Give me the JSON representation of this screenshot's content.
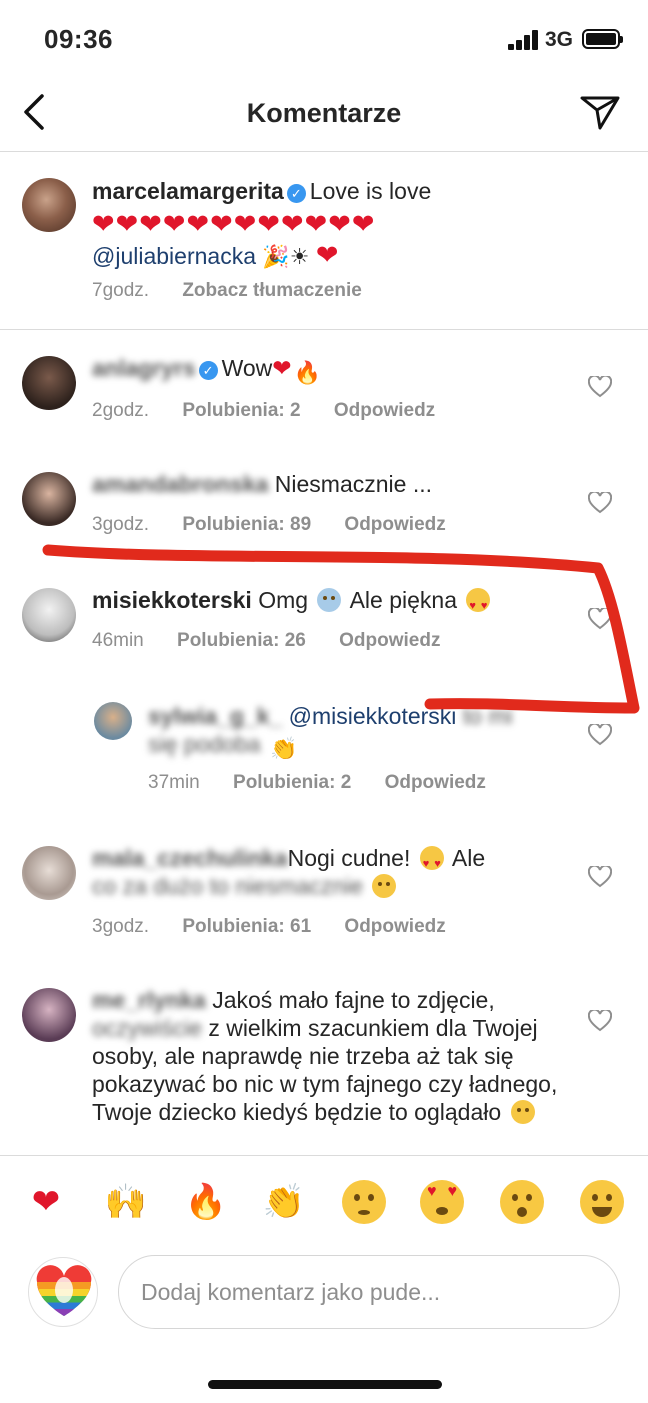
{
  "status": {
    "time": "09:36",
    "network": "3G"
  },
  "header": {
    "title": "Komentarze"
  },
  "caption": {
    "username": "marcelamargerita",
    "text": "Love is love",
    "hearts": "❤❤❤❤❤❤❤❤❤❤❤❤",
    "mention": "@juliabiernacka",
    "tail": "🎉☀",
    "heart": "❤",
    "time": "7godz.",
    "translate": "Zobacz tłumaczenie"
  },
  "comments": [
    {
      "username": "anlagryrs",
      "text": "Wow",
      "time": "2godz.",
      "likes": "Polubienia: 2",
      "reply": "Odpowiedz"
    },
    {
      "username": "amandabronska",
      "text": "Niesmacznie ...",
      "time": "3godz.",
      "likes": "Polubienia: 89",
      "reply": "Odpowiedz"
    },
    {
      "username": "misiekkoterski",
      "text_a": "Omg",
      "text_b": "Ale piękna",
      "time": "46min",
      "likes": "Polubienia: 26",
      "reply": "Odpowiedz"
    },
    {
      "username": "sylwia_g_k_",
      "mention": "@misiekkoterski",
      "text_a": "to mi",
      "text_b": "się podoba",
      "time": "37min",
      "likes": "Polubienia: 2",
      "reply": "Odpowiedz"
    },
    {
      "username": "mala_czechulinka",
      "text_a": "Nogi cudne!",
      "text_b": "Ale",
      "text_c": "co za dużo to niesmacznie",
      "time": "3godz.",
      "likes": "Polubienia: 61",
      "reply": "Odpowiedz"
    },
    {
      "username": "me_rlynka",
      "text_a": "Jakoś mało fajne to zdjęcie,",
      "text_b": "oczywiście",
      "text_c": "z wielkim szacunkiem dla Twojej osoby, ale naprawdę nie trzeba aż tak się pokazywać bo nic w tym fajnego czy ładnego, Twoje dziecko kiedyś będzie to oglądało"
    }
  ],
  "emoji_bar": [
    "heart",
    "raised-hands",
    "fire",
    "clap",
    "sad",
    "heart-eyes",
    "surprised",
    "joy"
  ],
  "composer": {
    "placeholder": "Dodaj komentarz jako pude..."
  },
  "colors": {
    "accent_red": "#e0162b",
    "link": "#1e3f6e",
    "muted": "#8e8e8e",
    "verified": "#3897f0"
  }
}
